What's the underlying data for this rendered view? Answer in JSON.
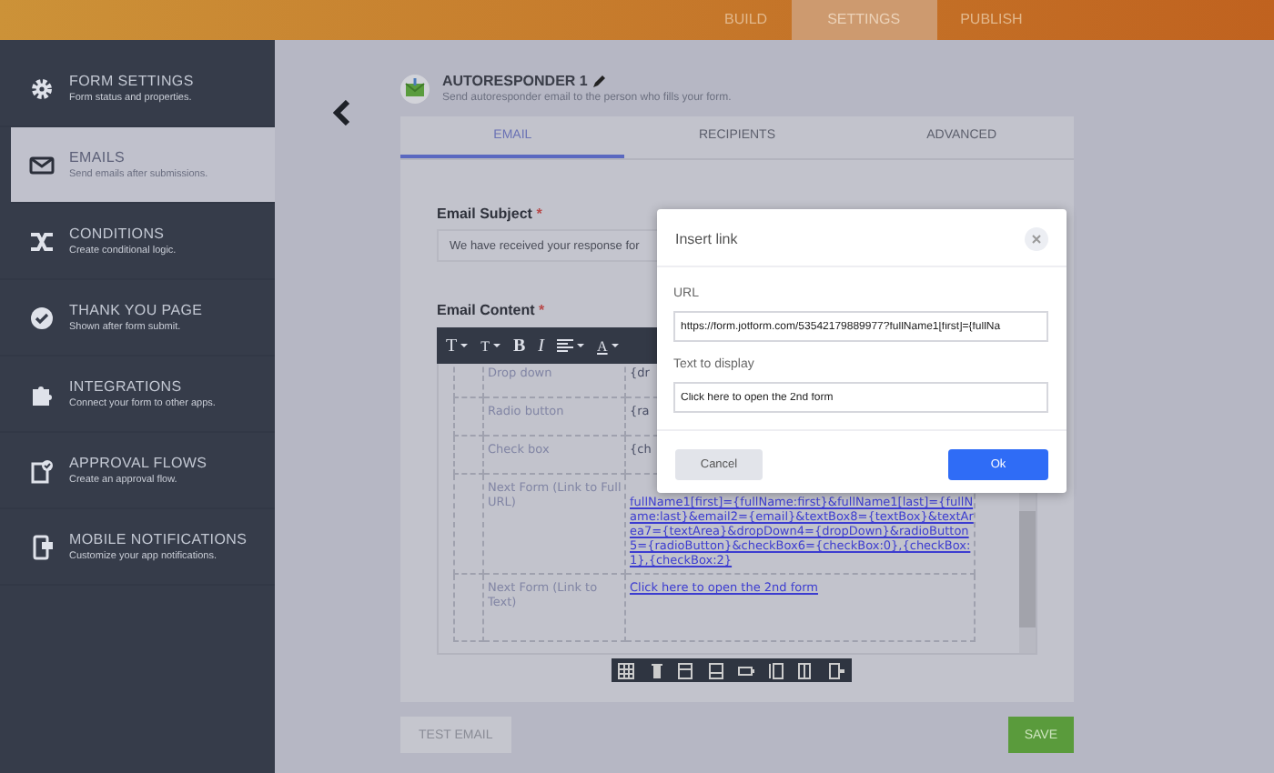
{
  "top_nav": [
    {
      "label": "BUILD",
      "selected": false
    },
    {
      "label": "SETTINGS",
      "selected": true
    },
    {
      "label": "PUBLISH",
      "selected": false
    }
  ],
  "sidebar": {
    "items": [
      {
        "title": "FORM SETTINGS",
        "description": "Form status and properties.",
        "selected": false
      },
      {
        "title": "EMAILS",
        "description": "Send emails after submissions.",
        "selected": true
      },
      {
        "title": "CONDITIONS",
        "description": "Create conditional logic.",
        "selected": false
      },
      {
        "title": "THANK YOU PAGE",
        "description": "Shown after form submit.",
        "selected": false
      },
      {
        "title": "INTEGRATIONS",
        "description": "Connect your form to other apps.",
        "selected": false
      },
      {
        "title": "APPROVAL FLOWS",
        "description": "Create an approval flow.",
        "selected": false
      },
      {
        "title": "MOBILE NOTIFICATIONS",
        "description": "Customize your app notifications.",
        "selected": false
      }
    ]
  },
  "header": {
    "title": "AUTORESPONDER 1",
    "subtitle": "Send autoresponder email to the person who fills your form."
  },
  "tabs": [
    {
      "label": "EMAIL",
      "selected": true
    },
    {
      "label": "RECIPIENTS",
      "selected": false
    },
    {
      "label": "ADVANCED",
      "selected": false
    }
  ],
  "email_subject": {
    "label": "Email Subject",
    "required_mark": "*",
    "value": "We have received your response for"
  },
  "email_content": {
    "label": "Email Content",
    "required_mark": "*",
    "toolbar": [
      {
        "label": "T",
        "caret": true,
        "kind": "text"
      },
      {
        "label": "T",
        "caret": true,
        "kind": "size"
      },
      {
        "label": "B",
        "caret": false,
        "kind": "bold"
      },
      {
        "label": "I",
        "caret": false,
        "kind": "italic"
      },
      {
        "caret": true,
        "kind": "align"
      },
      {
        "label": "A",
        "caret": true,
        "kind": "color"
      }
    ],
    "table_rows": [
      {
        "field": "Drop down",
        "value": "{dr",
        "kind": "tag"
      },
      {
        "field": "Radio button",
        "value": "{ra",
        "kind": "tag"
      },
      {
        "field": "Check box",
        "value": "{ch",
        "kind": "tag"
      },
      {
        "field": "Next Form (Link to Full URL)",
        "value": "fullName1[first]={fullName:first}&fullName1[last]={fullName:last}&email2={email}&textBox8={textBox}&textArea7={textArea}&dropDown4={dropDown}&radioButton5={radioButton}&checkBox6={checkBox:0},{checkBox:1},{checkBox:2}",
        "kind": "link"
      },
      {
        "field": "Next Form (Link to Text)",
        "value": "Click here to open the 2nd form",
        "kind": "link"
      }
    ]
  },
  "buttons": {
    "test": "TEST EMAIL",
    "save": "SAVE"
  },
  "dialog": {
    "title": "Insert link",
    "url_label": "URL",
    "url_value": "https://form.jotform.com/53542179889977?fullName1[first]={fullNa",
    "text_label": "Text to display",
    "text_value": "Click here to open the 2nd form",
    "cancel": "Cancel",
    "ok": "Ok"
  }
}
